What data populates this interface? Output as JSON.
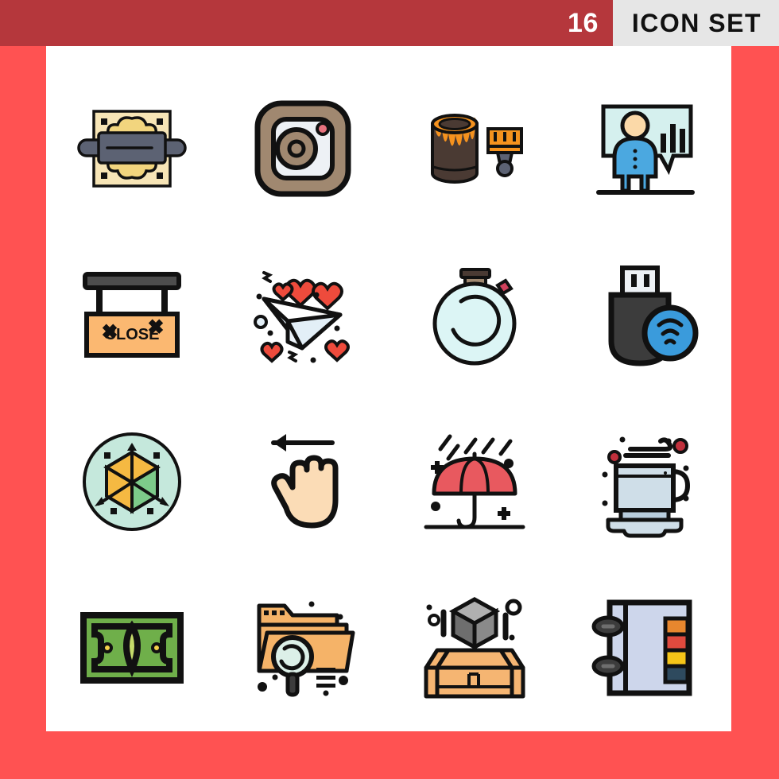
{
  "header": {
    "count": "16",
    "title": "ICON SET",
    "band_color": "#b5373c",
    "panel_color": "#e6e6e6",
    "count_color": "#ffffff",
    "title_color": "#111111"
  },
  "page": {
    "background_color": "#ff5252",
    "canvas_color": "#ffffff"
  },
  "palette": {
    "outline": "#111111",
    "cream": "#f7e5b6",
    "dough": "#f2d57e",
    "slate": "#5c6273",
    "brown": "#a08870",
    "pale_blue": "#edf1f5",
    "pink_dot": "#e8737f",
    "dark_brown": "#4a3a33",
    "orange": "#f5921e",
    "cyan_pale": "#d5f0ee",
    "blue": "#4ba8e0",
    "peach": "#fbd9a8",
    "sign_orange": "#fbb871",
    "gray_bar": "#4d4d4d",
    "paper_blue": "#e3eff7",
    "heart_red": "#ee4b3c",
    "timer_cyan": "#dcf5f5",
    "usb_dark": "#3c3c3c",
    "wifi_blue": "#3a9bdc",
    "mint": "#c5e8dc",
    "cube_red": "#e8645c",
    "cube_green": "#7dcb8a",
    "cube_yellow": "#f5b942",
    "skin": "#fbdcb6",
    "umbrella_red": "#e8595f",
    "cup_blue": "#cfdee8",
    "money_green": "#6faf4a",
    "money_light": "#c5db6a",
    "folder_orange": "#f5b368",
    "lens_mint": "#dcf0e8",
    "box_orange": "#f5b572",
    "cube_gray": "#9a9a9a",
    "notebook_blue": "#cdd6eb",
    "tab_orange": "#e8872e",
    "tab_red": "#e04a3e",
    "tab_yellow": "#f5c518",
    "tab_navy": "#2e4a5e"
  },
  "icons": [
    {
      "id": 1,
      "name": "rolling-pin-dough-icon",
      "label": "Rolling pin on dough board"
    },
    {
      "id": 2,
      "name": "camera-icon",
      "label": "Photo camera"
    },
    {
      "id": 3,
      "name": "paint-bucket-brush-icon",
      "label": "Paint bucket and brush"
    },
    {
      "id": 4,
      "name": "presentation-person-icon",
      "label": "Presenter with chart board"
    },
    {
      "id": 5,
      "name": "close-sign-icon",
      "label": "Hanging CLOSE sign",
      "text": "CLOSE"
    },
    {
      "id": 6,
      "name": "paper-plane-hearts-icon",
      "label": "Paper plane with hearts"
    },
    {
      "id": 7,
      "name": "stopwatch-icon",
      "label": "Stopwatch timer"
    },
    {
      "id": 8,
      "name": "usb-wifi-icon",
      "label": "USB drive with wifi"
    },
    {
      "id": 9,
      "name": "3d-cube-axes-icon",
      "label": "3D cube with axes"
    },
    {
      "id": 10,
      "name": "swipe-left-hand-icon",
      "label": "Hand swipe left gesture"
    },
    {
      "id": 11,
      "name": "umbrella-rain-icon",
      "label": "Umbrella in rain"
    },
    {
      "id": 12,
      "name": "coffee-cup-icon",
      "label": "Coffee cup on saucer"
    },
    {
      "id": 13,
      "name": "banknote-icon",
      "label": "Money banknote"
    },
    {
      "id": 14,
      "name": "folder-search-icon",
      "label": "Folder with magnifier"
    },
    {
      "id": 15,
      "name": "open-box-cube-icon",
      "label": "Open box with cube"
    },
    {
      "id": 16,
      "name": "notebook-tabs-icon",
      "label": "Notebook with colour tabs"
    }
  ]
}
